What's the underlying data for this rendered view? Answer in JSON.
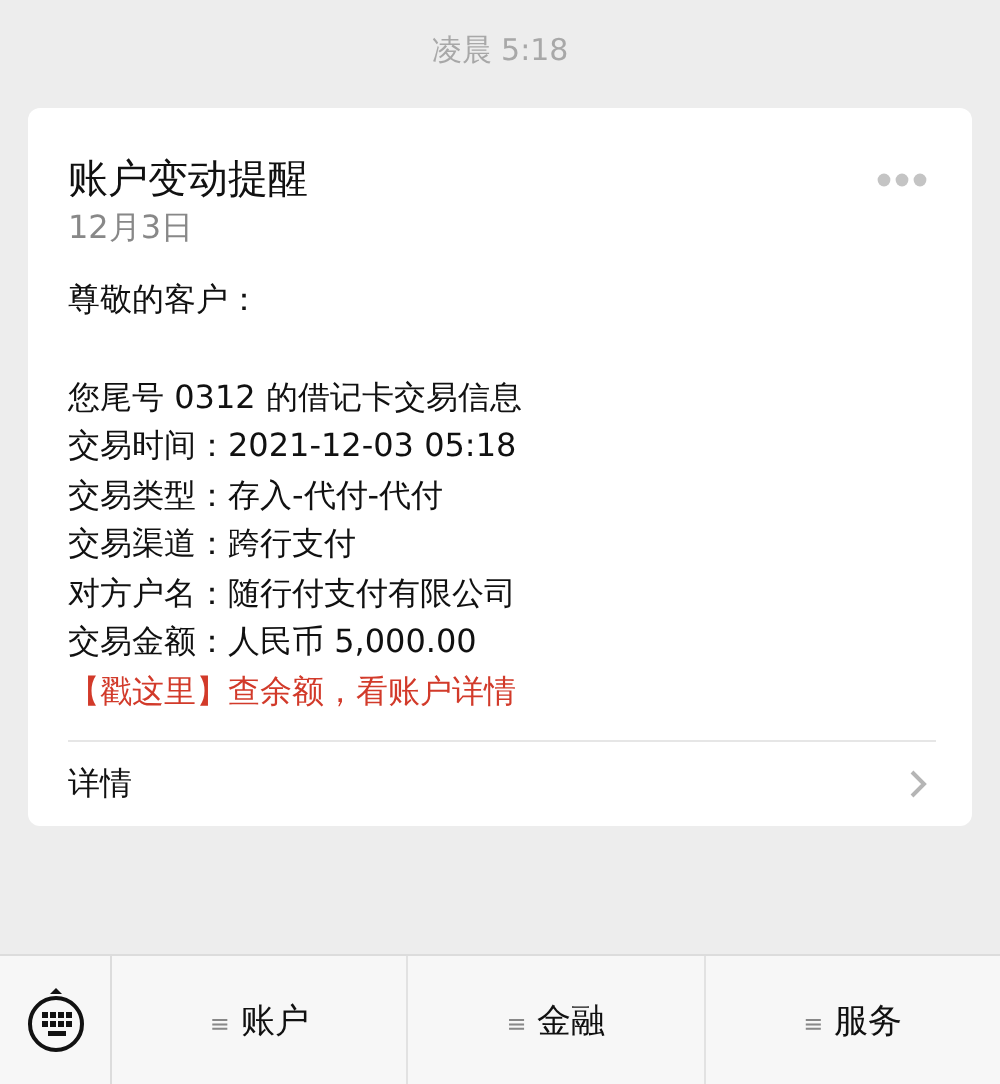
{
  "timestamp": "凌晨 5:18",
  "message": {
    "title": "账户变动提醒",
    "date": "12月3日",
    "greeting": "尊敬的客户：",
    "intro": "您尾号 0312 的借记卡交易信息",
    "fields": [
      {
        "label": "交易时间：",
        "value": "2021-12-03 05:18"
      },
      {
        "label": "交易类型：",
        "value": "存入-代付-代付"
      },
      {
        "label": "交易渠道：",
        "value": "跨行支付"
      },
      {
        "label": "对方户名：",
        "value": "随行付支付有限公司"
      },
      {
        "label": "交易金额：",
        "value": "人民币 5,000.00"
      }
    ],
    "link": "【戳这里】查余额，看账户详情",
    "details": "详情"
  },
  "menu": [
    {
      "glyph": "≡",
      "label": "账户"
    },
    {
      "glyph": "≡",
      "label": "金融"
    },
    {
      "glyph": "≡",
      "label": "服务"
    }
  ]
}
